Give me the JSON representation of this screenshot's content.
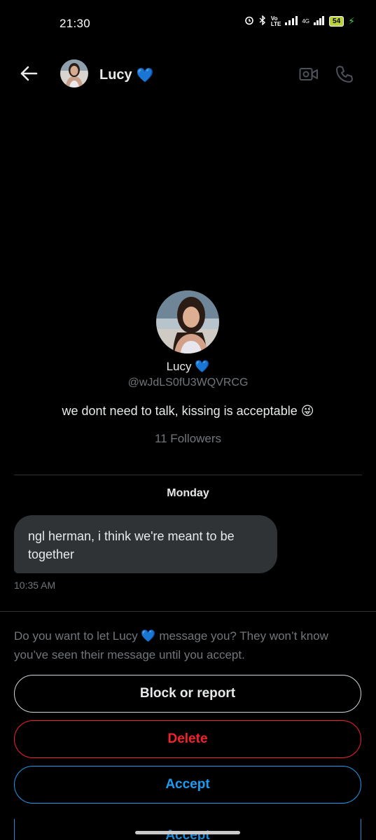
{
  "status_bar": {
    "time": "21:30",
    "battery": "54",
    "network": "4G",
    "icons": [
      "alarm-icon",
      "bluetooth-icon",
      "volte-icon",
      "signal-icon",
      "battery-icon",
      "charging-icon"
    ]
  },
  "header": {
    "name": "Lucy",
    "badge_emoji": "💙",
    "icons": [
      "back-arrow-icon",
      "video-call-icon",
      "phone-call-icon"
    ]
  },
  "profile": {
    "name": "Lucy",
    "badge_emoji": "💙",
    "handle": "@wJdLS0fU3WQVRCG",
    "bio": "we dont need to talk, kissing is acceptable 😜",
    "followers": "11 Followers"
  },
  "conversation": {
    "day_label": "Monday",
    "messages": [
      {
        "text": "ngl herman, i think we're meant to be together",
        "time": "10:35 AM"
      }
    ]
  },
  "request": {
    "prompt": "Do you want to let Lucy 💙 message you? They won’t know you’ve seen their message until you accept.",
    "block_label": "Block or report",
    "delete_label": "Delete",
    "accept_label": "Accept",
    "accept_ghost_label": "Accept"
  },
  "colors": {
    "background": "#000000",
    "accent": "#1d9bf0",
    "danger": "#f4212e",
    "muted": "#71767b",
    "bubble": "#2f3336"
  }
}
